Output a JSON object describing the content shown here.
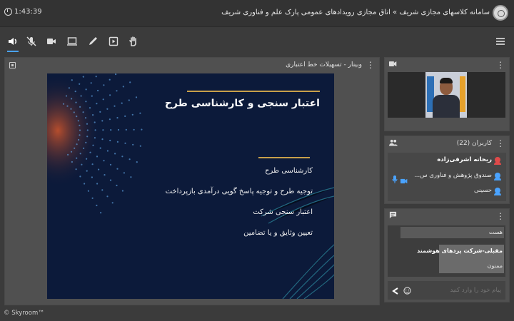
{
  "header": {
    "time": "1:43:39",
    "title": "سامانه کلاسهای مجازی شریف » اتاق مجازی رویدادهای عمومی پارک علم و فناوری شریف"
  },
  "presentation": {
    "title": "وبینار - تسهیلات خط اعتباری",
    "slide_title": "اعتبار سنجی و کارشناسی طرح",
    "items": [
      "کارشناسی طرح",
      "توجیه طرح و توجیه پاسخ گویی درآمدی بازپرداخت",
      "اعتبار سنجی شرکت",
      "تعیین وثایق و یا تضامین"
    ]
  },
  "users": {
    "title": "کاربران (22)",
    "list": [
      {
        "name": "ریحانه اشرفی‌زاده",
        "color": "#e04a4a"
      },
      {
        "name": "صندوق پژوهش و فناوری س...",
        "color": "#4aa3ff"
      },
      {
        "name": "حسینی",
        "color": "#4aa3ff"
      }
    ]
  },
  "chat": {
    "messages": [
      "هست",
      "مقبلی-شرکت پردهای هوشمند",
      "ممنون"
    ],
    "input_placeholder": "پیام خود را وارد کنید"
  },
  "footer": {
    "brand": "© Skyroom™"
  },
  "colors": {
    "accent": "#4aa3ff",
    "gold": "#c8a04a",
    "slide_bg": "#0c1a3a"
  },
  "icons": [
    "clock-icon",
    "speaker-icon",
    "mic-off-icon",
    "camera-icon",
    "screen-share-icon",
    "pen-icon",
    "play-icon",
    "hand-icon",
    "menu-icon"
  ]
}
